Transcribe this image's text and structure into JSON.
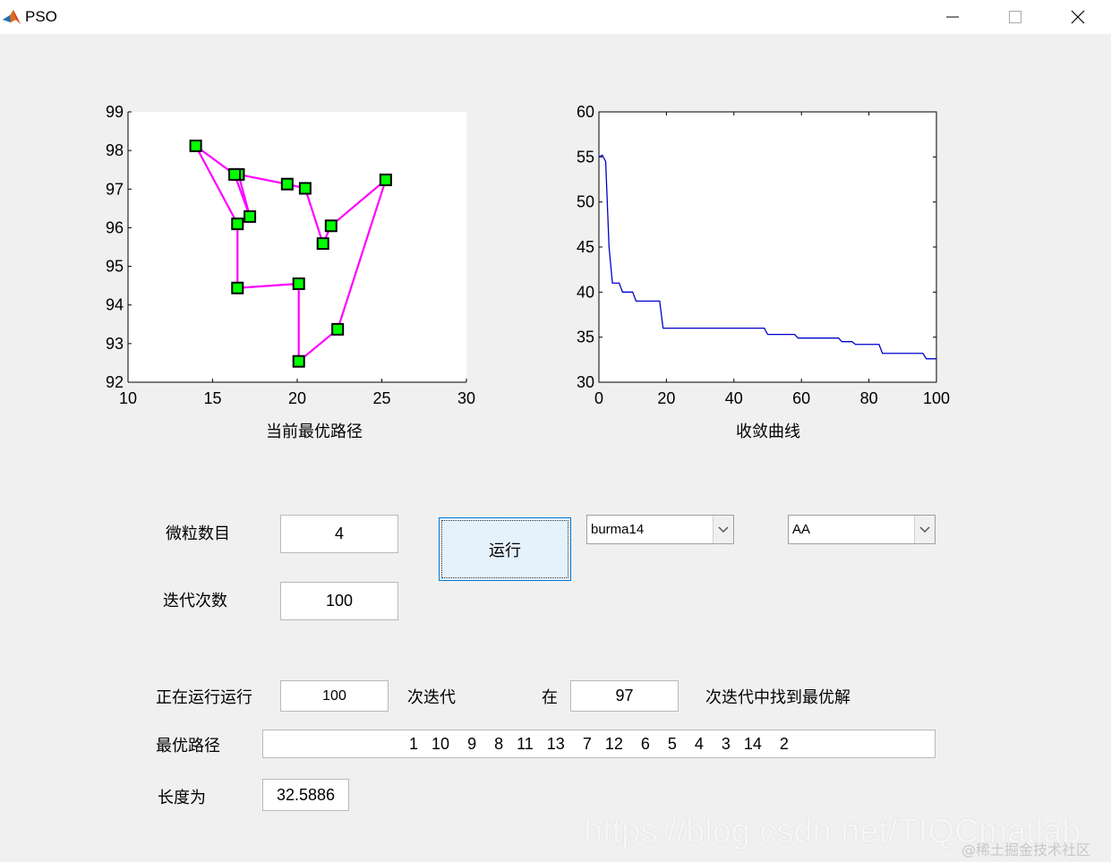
{
  "window": {
    "title": "PSO",
    "icon": "matlab-logo-icon",
    "controls": [
      "minimize-icon",
      "maximize-icon",
      "close-icon"
    ]
  },
  "route_plot": {
    "caption": "当前最优路径",
    "chart_data": {
      "type": "scatter",
      "xlim": [
        10,
        30
      ],
      "ylim": [
        92,
        99
      ],
      "xticks": [
        10,
        15,
        20,
        25,
        30
      ],
      "yticks": [
        92,
        93,
        94,
        95,
        96,
        97,
        98,
        99
      ],
      "grid": false,
      "points": [
        {
          "x": 14.0,
          "y": 98.12
        },
        {
          "x": 16.47,
          "y": 96.1
        },
        {
          "x": 16.47,
          "y": 94.44
        },
        {
          "x": 20.09,
          "y": 94.55
        },
        {
          "x": 20.09,
          "y": 92.54
        },
        {
          "x": 22.39,
          "y": 93.37
        },
        {
          "x": 25.23,
          "y": 97.24
        },
        {
          "x": 22.0,
          "y": 96.05
        },
        {
          "x": 21.52,
          "y": 95.59
        },
        {
          "x": 20.47,
          "y": 97.02
        },
        {
          "x": 19.41,
          "y": 97.13
        },
        {
          "x": 16.53,
          "y": 97.38
        },
        {
          "x": 17.2,
          "y": 96.29
        },
        {
          "x": 16.3,
          "y": 97.38
        }
      ],
      "line_color": "#ff00ff",
      "marker_color": "#00ff00"
    }
  },
  "convergence_plot": {
    "caption": "收敛曲线",
    "chart_data": {
      "type": "line",
      "xlim": [
        0,
        100
      ],
      "ylim": [
        30,
        60
      ],
      "xticks": [
        0,
        20,
        40,
        60,
        80,
        100
      ],
      "yticks": [
        30,
        35,
        40,
        45,
        50,
        55,
        60
      ],
      "grid": false,
      "line_color": "#0000cc",
      "points": [
        [
          0,
          55
        ],
        [
          1,
          55.2
        ],
        [
          2,
          54.5
        ],
        [
          3,
          45
        ],
        [
          4,
          41
        ],
        [
          6,
          41
        ],
        [
          7,
          40
        ],
        [
          10,
          40
        ],
        [
          11,
          39
        ],
        [
          18,
          39
        ],
        [
          19,
          36
        ],
        [
          49,
          36
        ],
        [
          50,
          35.3
        ],
        [
          58,
          35.3
        ],
        [
          59,
          34.9
        ],
        [
          71,
          34.9
        ],
        [
          72,
          34.5
        ],
        [
          75,
          34.5
        ],
        [
          76,
          34.2
        ],
        [
          83,
          34.2
        ],
        [
          84,
          33.2
        ],
        [
          96,
          33.2
        ],
        [
          97,
          32.6
        ],
        [
          100,
          32.6
        ]
      ]
    }
  },
  "controls": {
    "particle_count_label": "微粒数目",
    "particle_count_value": "4",
    "iterations_label": "迭代次数",
    "iterations_value": "100",
    "run_label": "运行",
    "dataset_value": "burma14",
    "algorithm_value": "AA"
  },
  "status": {
    "running_label": "正在运行运行",
    "running_value": "100",
    "iter_label": "次迭代",
    "at_label": "在",
    "found_value": "97",
    "found_label": "次迭代中找到最优解",
    "best_path_label": "最优路径",
    "best_path_value": "1   10    9    8   11   13    7   12    6    5    4    3   14    2",
    "length_label": "长度为",
    "length_value": "32.5886"
  },
  "watermark": {
    "url": "https://blog.csdn.net/TIQCmatlab",
    "site": "@稀土掘金技术社区"
  }
}
